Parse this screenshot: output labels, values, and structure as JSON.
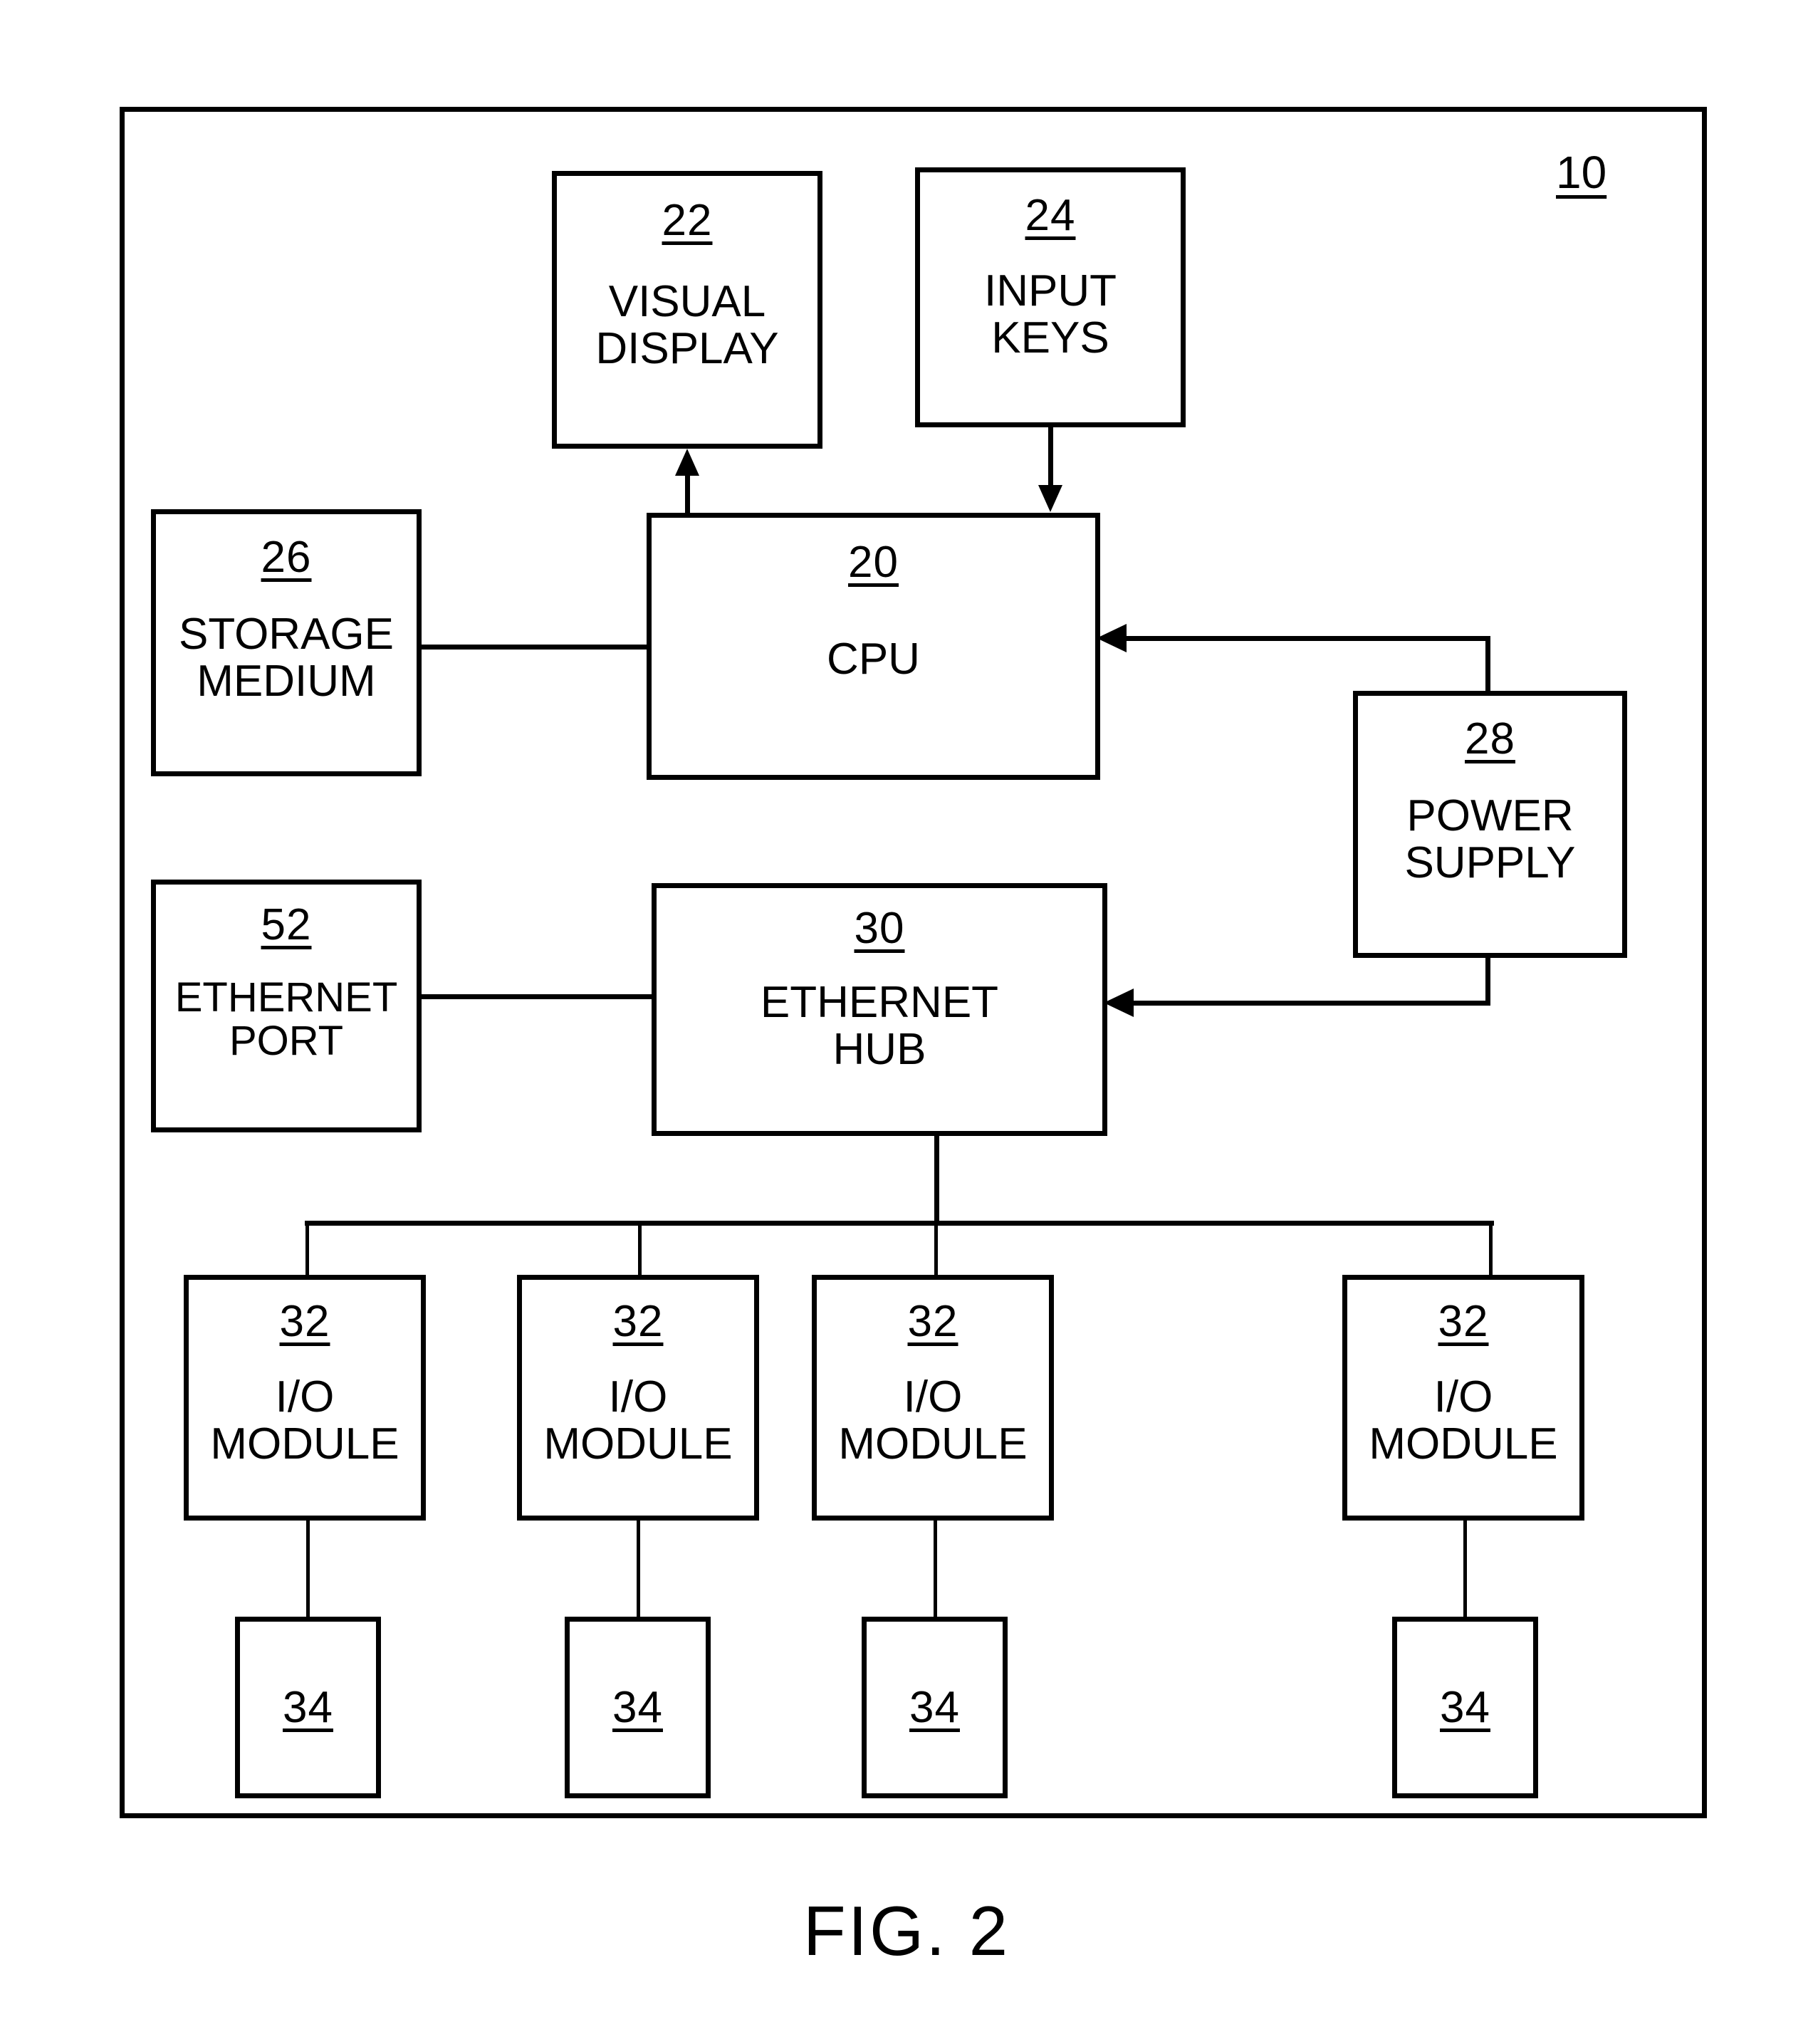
{
  "figure": {
    "caption": "FIG. 2",
    "system_ref": "10"
  },
  "blocks": {
    "visual_display": {
      "ref": "22",
      "label": "VISUAL\nDISPLAY"
    },
    "input_keys": {
      "ref": "24",
      "label": "INPUT\nKEYS"
    },
    "storage_medium": {
      "ref": "26",
      "label": "STORAGE\nMEDIUM"
    },
    "cpu": {
      "ref": "20",
      "label": "CPU"
    },
    "power_supply": {
      "ref": "28",
      "label": "POWER\nSUPPLY"
    },
    "ethernet_port": {
      "ref": "52",
      "label": "ETHERNET\nPORT"
    },
    "ethernet_hub": {
      "ref": "30",
      "label": "ETHERNET\nHUB"
    }
  },
  "io_modules": [
    {
      "ref": "32",
      "label": "I/O\nMODULE"
    },
    {
      "ref": "32",
      "label": "I/O\nMODULE"
    },
    {
      "ref": "32",
      "label": "I/O\nMODULE"
    },
    {
      "ref": "32",
      "label": "I/O\nMODULE"
    }
  ],
  "devices": [
    {
      "ref": "34"
    },
    {
      "ref": "34"
    },
    {
      "ref": "34"
    },
    {
      "ref": "34"
    }
  ],
  "colors": {
    "ink": "#000000",
    "paper": "#ffffff"
  }
}
